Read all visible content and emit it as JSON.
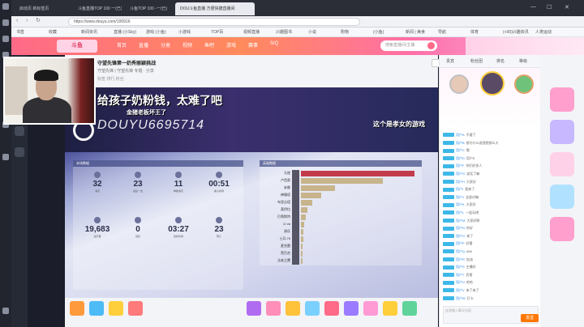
{
  "browser": {
    "tabs": [
      {
        "label": "启动页 新标签页"
      },
      {
        "label": "斗鱼直播TOP 100 一(已)"
      },
      {
        "label": "斗鱼TOP 100 -一(已)"
      },
      {
        "label": "DOU斗鱼直播 方便快捷直播间"
      }
    ],
    "address": "https://www.douyu.com/100916",
    "bookmarks": [
      "书签",
      "收藏",
      "新闻资讯",
      "直播 (小Sky)",
      "游戏 (小鱼)",
      "小游戏",
      "TOP百",
      "视频直播",
      "兴趣图书",
      "小说",
      "购物",
      "(小鱼)",
      "新闻 | 美食",
      "导航",
      "体育",
      "(+00)兴趣资讯",
      "人类运动"
    ]
  },
  "site": {
    "logo_text": "斗鱼",
    "nav": [
      "首页",
      "直播",
      "分类",
      "视频",
      "鱼吧",
      "游戏",
      "赛事",
      "S/Q"
    ],
    "search_placeholder": "搜索直播间/主播"
  },
  "room": {
    "title": "守望先锋第一奶秀丽颖挑战",
    "meta": "守望先锋  |  守望先锋   专题 · 分享",
    "tags": "标签  排行  粉丝",
    "follow_label": "+关注",
    "share_label": "分享"
  },
  "video": {
    "danmaku": [
      {
        "text": "给孩子奶粉钱，太难了吧"
      },
      {
        "text": "金猪老板坏王了"
      },
      {
        "text": "这个是孝女的游戏"
      }
    ],
    "watermark": "DOUYU6695714",
    "left_panel_title": "本场数据",
    "right_panel_title": "英雄数据",
    "stats": [
      {
        "value": "32",
        "label": "消灭"
      },
      {
        "value": "23",
        "label": "最后一击"
      },
      {
        "value": "11",
        "label": "单独消灭"
      },
      {
        "value": "00:51",
        "label": "着火时间"
      },
      {
        "value": "19,683",
        "label": "治疗量"
      },
      {
        "value": "0",
        "label": "目标"
      },
      {
        "value": "03:27",
        "label": "目标时间"
      },
      {
        "value": "23",
        "label": "阵亡"
      }
    ],
    "heroes": [
      {
        "name": "天使",
        "share": 1.0,
        "color": "#c23b4b"
      },
      {
        "name": "卢西奥",
        "share": 0.72,
        "color": "#c7b48a"
      },
      {
        "name": "安娜",
        "share": 0.3,
        "color": "#c7b48a"
      },
      {
        "name": "禅雅塔",
        "share": 0.18,
        "color": "#c7b48a"
      },
      {
        "name": "布里吉塔",
        "share": 0.1,
        "color": "#c7b48a"
      },
      {
        "name": "莫伊拉",
        "share": 0.06,
        "color": "#c7b48a"
      },
      {
        "name": "巴蒂斯特",
        "share": 0.04,
        "color": "#c7b48a"
      },
      {
        "name": "D.Va",
        "share": 0.03,
        "color": "#c7b48a"
      },
      {
        "name": "源氏",
        "share": 0.02,
        "color": "#c7b48a"
      },
      {
        "name": "士兵:76",
        "share": 0.02,
        "color": "#c7b48a"
      },
      {
        "name": "麦克雷",
        "share": 0.01,
        "color": "#c7b48a"
      },
      {
        "name": "黑百合",
        "share": 0.01,
        "color": "#c7b48a"
      },
      {
        "name": "法老之鹰",
        "share": 0.01,
        "color": "#c7b48a"
      }
    ]
  },
  "chat": {
    "tabs": [
      "贵宾",
      "粉丝团",
      "排名",
      "等级"
    ],
    "messages": [
      {
        "nick": "用户A",
        "text": "不要了"
      },
      {
        "nick": "用户B",
        "text": "那为什么说我错那么大"
      },
      {
        "nick": "用户C",
        "text": "哦"
      },
      {
        "nick": "用户D",
        "text": "用户E"
      },
      {
        "nick": "用户F",
        "text": "你们好多人"
      },
      {
        "nick": "用户G",
        "text": "说话了嘛"
      },
      {
        "nick": "用户H",
        "text": "大家好"
      },
      {
        "nick": "用户I",
        "text": "我来了"
      },
      {
        "nick": "用户J",
        "text": "全部对嘛"
      },
      {
        "nick": "用户K",
        "text": "大家好"
      },
      {
        "nick": "用户L",
        "text": "一起玩吧"
      },
      {
        "nick": "用户M",
        "text": "大家好啊"
      },
      {
        "nick": "用户N",
        "text": "你好"
      },
      {
        "nick": "用户O",
        "text": "来了"
      },
      {
        "nick": "用户P",
        "text": "好看"
      },
      {
        "nick": "用户Q",
        "text": "666"
      },
      {
        "nick": "用户R",
        "text": "加油"
      },
      {
        "nick": "用户S",
        "text": "主播好"
      },
      {
        "nick": "用户T",
        "text": "厉害"
      },
      {
        "nick": "用户U",
        "text": "哈哈"
      },
      {
        "nick": "用户V",
        "text": "来了来了"
      },
      {
        "nick": "用户W",
        "text": "打卡"
      }
    ],
    "input_placeholder": "这里输入聊天内容",
    "send_label": "发送"
  }
}
